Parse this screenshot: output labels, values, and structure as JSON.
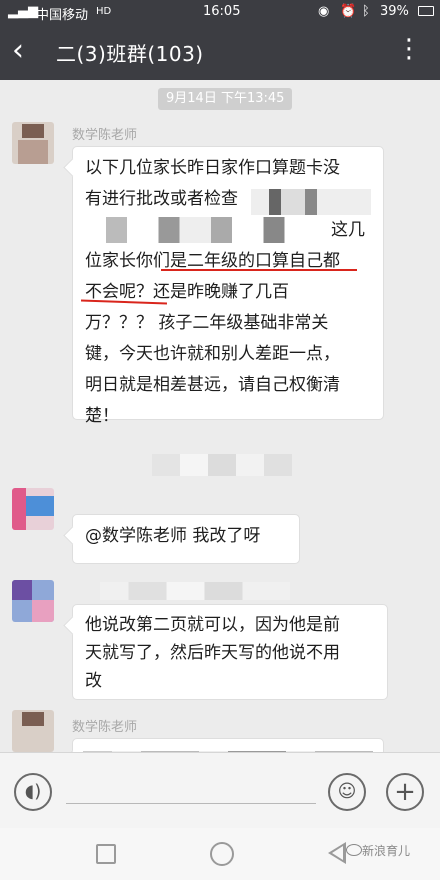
{
  "status": {
    "carrier": "中国移动",
    "network": "HD",
    "time": "16:05",
    "battery": "39%"
  },
  "header": {
    "title": "二(3)班群(103)",
    "more": "⋮"
  },
  "chat": {
    "timestamp": "9月14日 下午13:45",
    "messages": [
      {
        "sender": "数学陈老师",
        "lines": [
          "以下几位家长昨日家作口算题卡没",
          "有进行批改或者检查",
          "这几",
          "位家长你们是二年级的口算自己都",
          "不会呢？还是昨晚赚了几百",
          "万？？？ 孩子二年级基础非常关",
          "键，今天也许就和别人差距一点，",
          "明日就是相差甚远，请自己权衡清",
          "楚！"
        ]
      },
      {
        "sender": "",
        "text": "@数学陈老师  我改了呀"
      },
      {
        "sender": "",
        "lines": [
          "他说改第二页就可以，因为他是前",
          "天就写了，然后昨天写的他说不用",
          "改"
        ]
      },
      {
        "sender": "数学陈老师",
        "partial": ""
      }
    ]
  },
  "input": {
    "voice_icon": "voice-icon",
    "emoji_icon": "emoji-icon",
    "plus_icon": "plus-icon",
    "plus": "+"
  },
  "watermark": "新浪育儿"
}
